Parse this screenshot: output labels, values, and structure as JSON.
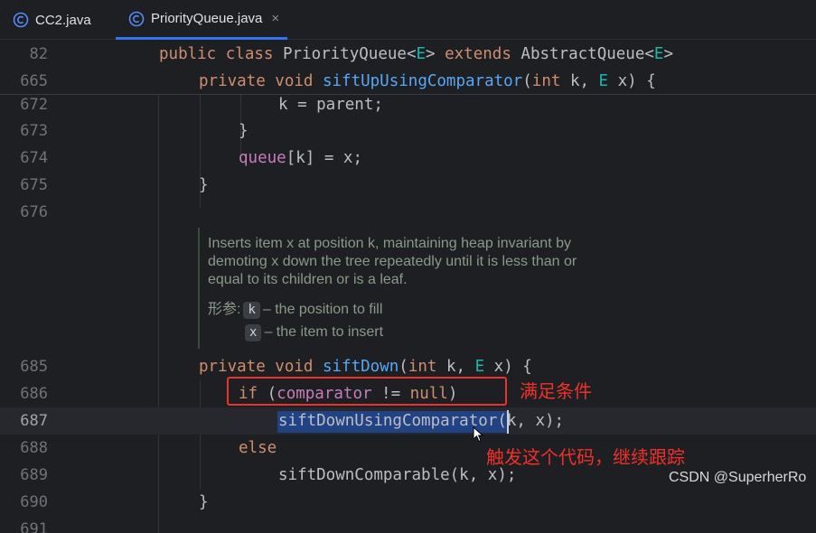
{
  "tabs": [
    {
      "label": "CC2.java",
      "icon": "java-class-icon",
      "active": false
    },
    {
      "label": "PriorityQueue.java",
      "icon": "java-class-icon",
      "active": true,
      "close": "×"
    }
  ],
  "sticky_lines": [
    {
      "num": "82",
      "kw1": "public class ",
      "name": "PriorityQueue",
      "p1": "<",
      "t1": "E",
      "p2": "> ",
      "kw2": "extends ",
      "name2": "AbstractQueue",
      "p3": "<",
      "t2": "E",
      "p4": ">"
    },
    {
      "num": "665",
      "kw1": "private void ",
      "fn": "siftUpUsingComparator",
      "p1": "(",
      "kw2": "int ",
      "p2": "k, ",
      "t1": "E ",
      "p3": "x) {"
    }
  ],
  "lines": {
    "l672": {
      "num": "672",
      "text": "k = parent;"
    },
    "l673": {
      "num": "673",
      "text": "}"
    },
    "l674": {
      "num": "674",
      "field": "queue",
      "text": "[k] = x;"
    },
    "l675": {
      "num": "675",
      "text": "}"
    },
    "l676": {
      "num": "676"
    },
    "l685": {
      "num": "685",
      "kw1": "private void ",
      "fn": "siftDown",
      "p1": "(",
      "kw2": "int ",
      "p2": "k, ",
      "t1": "E ",
      "p3": "x) {"
    },
    "l686": {
      "num": "686",
      "kw1": "if ",
      "p1": "(",
      "field": "comparator",
      "p2": " != ",
      "kw2": "null",
      "p3": ")"
    },
    "l687": {
      "num": "687",
      "fn": "siftDownUsingComparator",
      "text": "(k, x);"
    },
    "l688": {
      "num": "688",
      "kw1": "else"
    },
    "l689": {
      "num": "689",
      "text": "siftDownComparable(k, x);"
    },
    "l690": {
      "num": "690",
      "text": "}"
    },
    "l691": {
      "num": "691"
    }
  },
  "doc": {
    "line1": "Inserts item x at position k, maintaining heap invariant by",
    "line2": "demoting x down the tree repeatedly until it is less than or",
    "line3": "equal to its children or is a leaf.",
    "params_label": "形参:",
    "param1_name": "k",
    "param1_desc": "– the position to fill",
    "param2_name": "x",
    "param2_desc": "– the item to insert"
  },
  "annotations": {
    "condition": "满足条件",
    "trigger": "触发这个代码，继续跟踪"
  },
  "watermark": "CSDN @SuperherRo",
  "colors": {
    "background": "#1e1f22",
    "keyword": "#cf8e6d",
    "function": "#56a8f5",
    "type_param": "#16baac",
    "field": "#c77dbb",
    "annotation_red": "#f2302a",
    "selection": "#214283"
  }
}
